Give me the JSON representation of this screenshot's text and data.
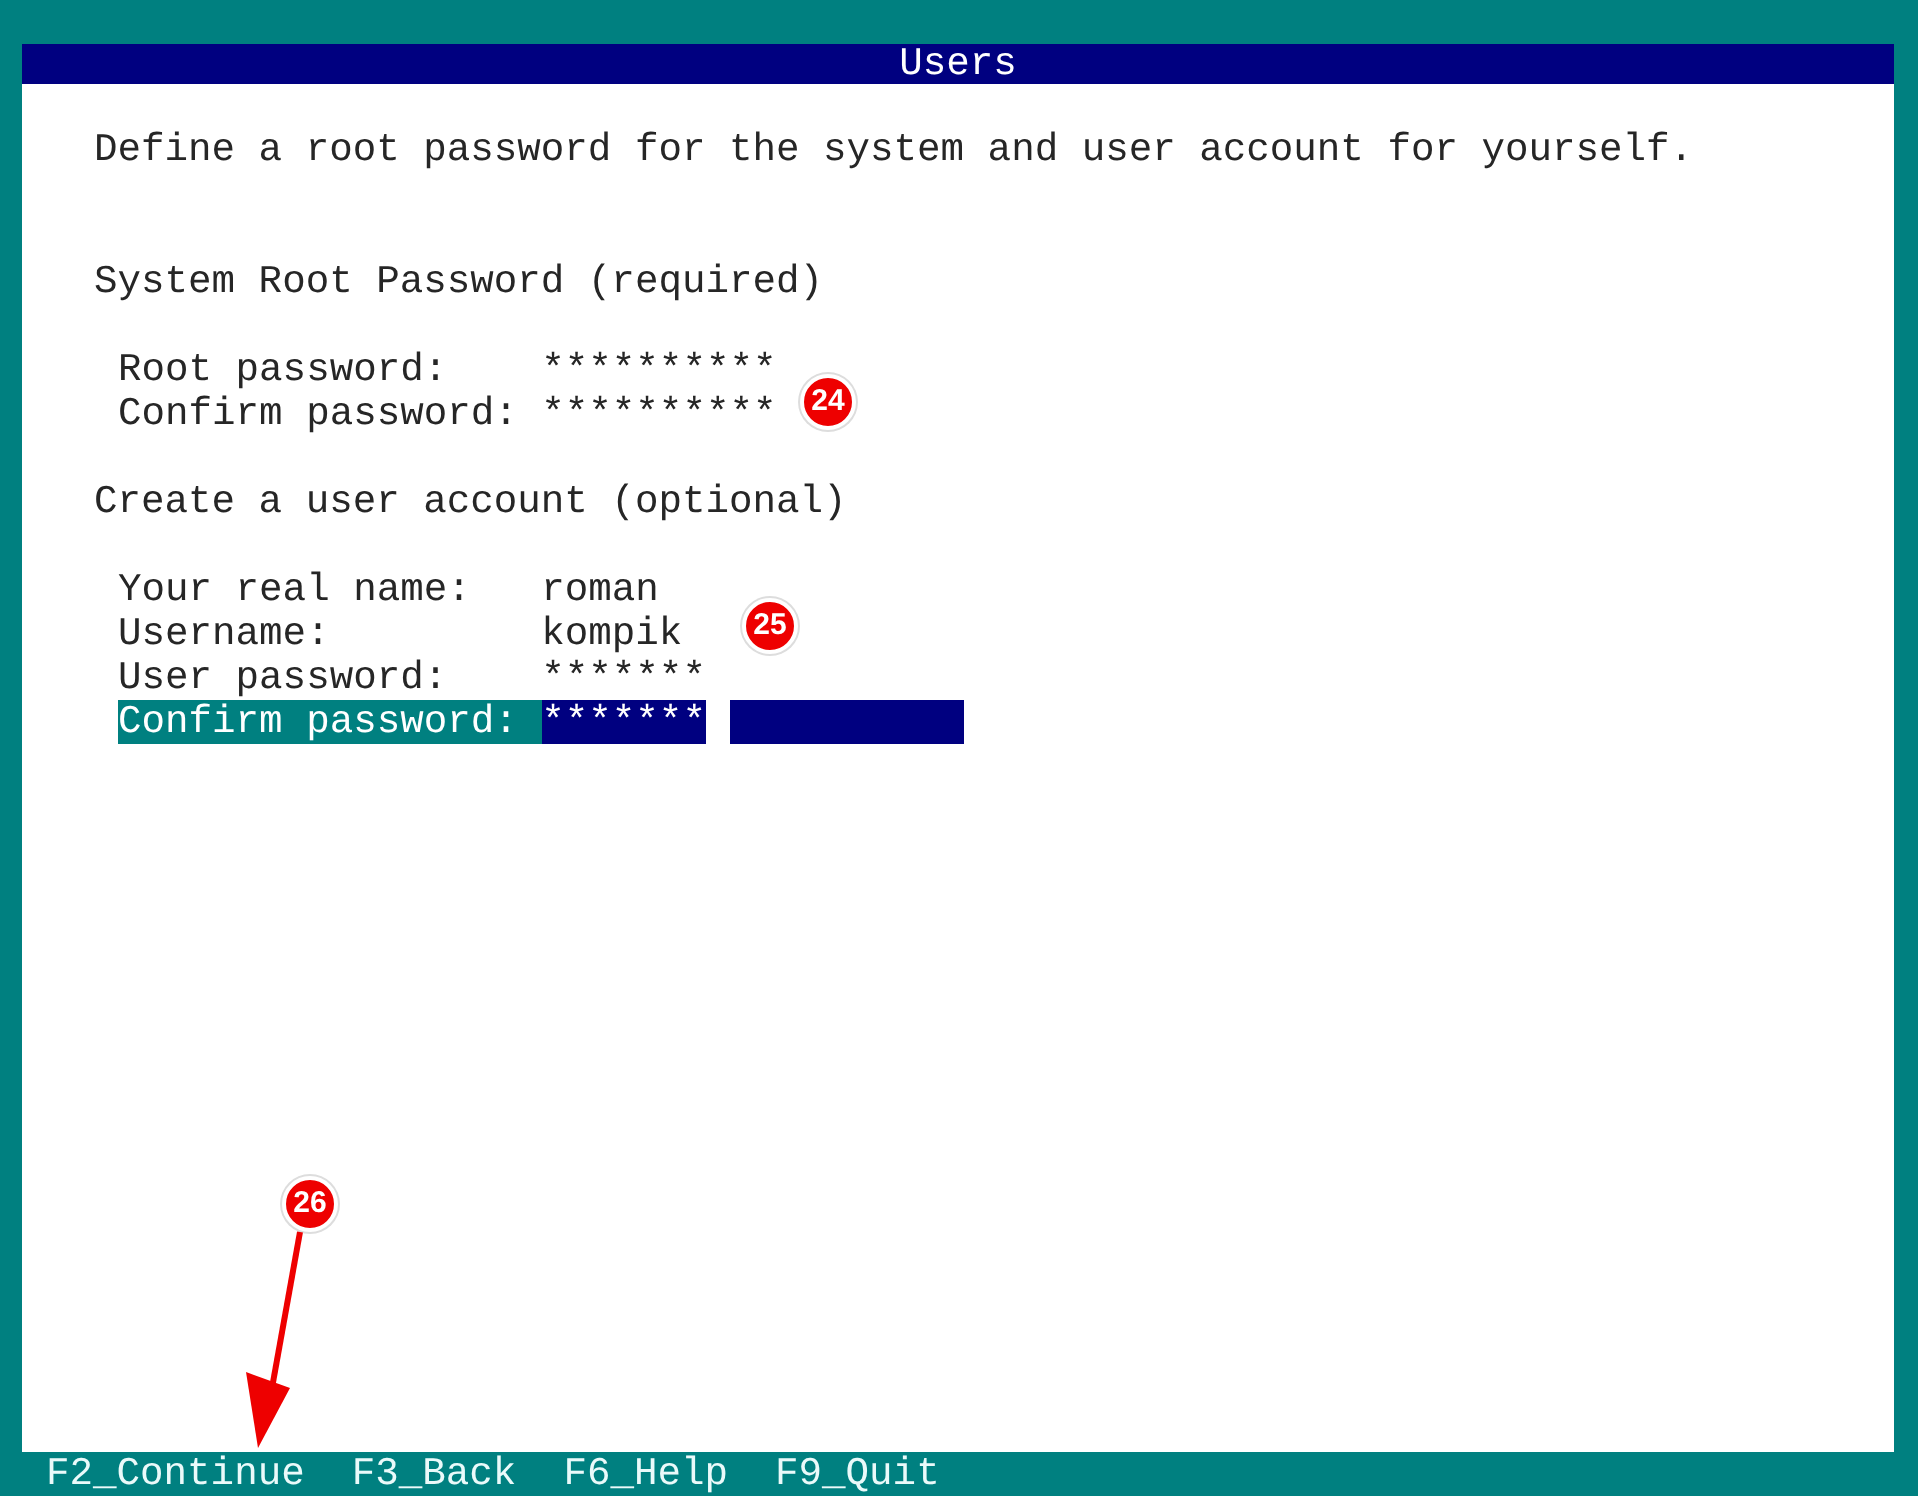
{
  "window": {
    "title": "Users"
  },
  "intro": "Define a root password for the system and user account for yourself.",
  "sections": [
    {
      "heading": "System Root Password (required)",
      "annotation": "24",
      "fields": [
        {
          "label": "Root password:",
          "value": "**********",
          "focused": false
        },
        {
          "label": "Confirm password:",
          "value": "**********",
          "focused": false
        }
      ]
    },
    {
      "heading": "Create a user account (optional)",
      "annotation": "25",
      "fields": [
        {
          "label": "Your real name:",
          "value": "roman",
          "focused": false
        },
        {
          "label": "Username:",
          "value": "kompik",
          "focused": false
        },
        {
          "label": "User password:",
          "value": "*******",
          "focused": false
        },
        {
          "label": "Confirm password:",
          "value": "*******",
          "focused": true
        }
      ]
    }
  ],
  "footer_annotation": "26",
  "footer_keys": [
    "F2_Continue",
    "F3_Back",
    "F6_Help",
    "F9_Quit"
  ]
}
